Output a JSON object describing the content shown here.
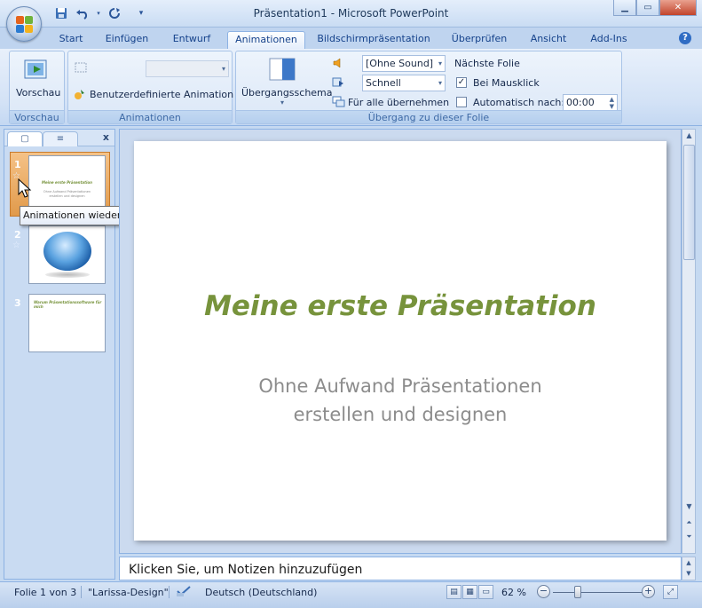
{
  "window": {
    "title": "Präsentation1 - Microsoft PowerPoint"
  },
  "qat": {
    "save_icon": "save-icon",
    "undo_icon": "undo-icon",
    "redo_icon": "redo-icon"
  },
  "tabs": [
    {
      "label": "Start"
    },
    {
      "label": "Einfügen"
    },
    {
      "label": "Entwurf"
    },
    {
      "label": "Animationen",
      "active": true
    },
    {
      "label": "Bildschirmpräsentation"
    },
    {
      "label": "Überprüfen"
    },
    {
      "label": "Ansicht"
    },
    {
      "label": "Add-Ins"
    }
  ],
  "ribbon": {
    "vorschau": {
      "button_label": "Vorschau",
      "group_label": "Vorschau"
    },
    "animationen": {
      "custom_anim_label": "Benutzerdefinierte Animation",
      "group_label": "Animationen",
      "animate_value": ""
    },
    "uebergang": {
      "schema_label": "Übergangsschema",
      "sound_value": "[Ohne Sound]",
      "speed_value": "Schnell",
      "apply_all_label": "Für alle übernehmen",
      "next_slide_heading": "Nächste Folie",
      "on_click_label": "Bei Mausklick",
      "on_click_checked": true,
      "auto_label": "Automatisch nach:",
      "auto_checked": false,
      "auto_time": "00:00",
      "group_label": "Übergang zu dieser Folie"
    }
  },
  "slides_pane": {
    "close_label": "x",
    "slides": [
      {
        "number": "1",
        "title": "Meine erste Präsentation",
        "subtitle": "Ohne Aufwand Präsentationen erstellen und designen",
        "selected": true
      },
      {
        "number": "2"
      },
      {
        "number": "3",
        "title": "Warum Präsentationssoftware für mich"
      }
    ]
  },
  "tooltip": "Animationen wiedergeben",
  "slide": {
    "title": "Meine erste Präsentation",
    "subtitle_line1": "Ohne Aufwand Präsentationen",
    "subtitle_line2": "erstellen und designen"
  },
  "notes": {
    "placeholder": "Klicken Sie, um  Notizen hinzuzufügen"
  },
  "status": {
    "slide_info": "Folie 1 von 3",
    "theme": "\"Larissa-Design\"",
    "language": "Deutsch (Deutschland)",
    "zoom": "62 %"
  },
  "colors": {
    "title_green": "#77933c",
    "subtitle_gray": "#8c8c8c",
    "selection_orange": "#e19a4b"
  }
}
